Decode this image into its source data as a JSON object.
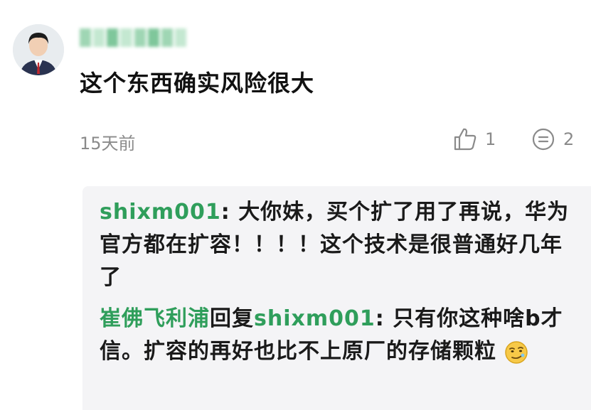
{
  "comment": {
    "text": "这个东西确实风险很大",
    "time": "15天前",
    "like_count": "1",
    "reply_count": "2"
  },
  "replies": [
    {
      "author": "shixm001",
      "separator": ": ",
      "text": "大你妹，买个扩了用了再说，华为官方都在扩容！！！！这个技术是很普通好几年了"
    },
    {
      "author": "崔佛飞利浦",
      "reply_word": "回复",
      "target": "shixm001",
      "separator": ": ",
      "text": "只有你这种啥b才信。扩容的再好也比不上原厂的存储颗粒"
    }
  ],
  "icons": {
    "like": "thumbs-up-icon",
    "reply": "comment-bubble-icon",
    "emoji": "smirk-emoji-icon"
  },
  "colors": {
    "name_green": "#2f9e5b",
    "meta_gray": "#8a8a8a",
    "reply_bg": "#f4f4f6"
  }
}
